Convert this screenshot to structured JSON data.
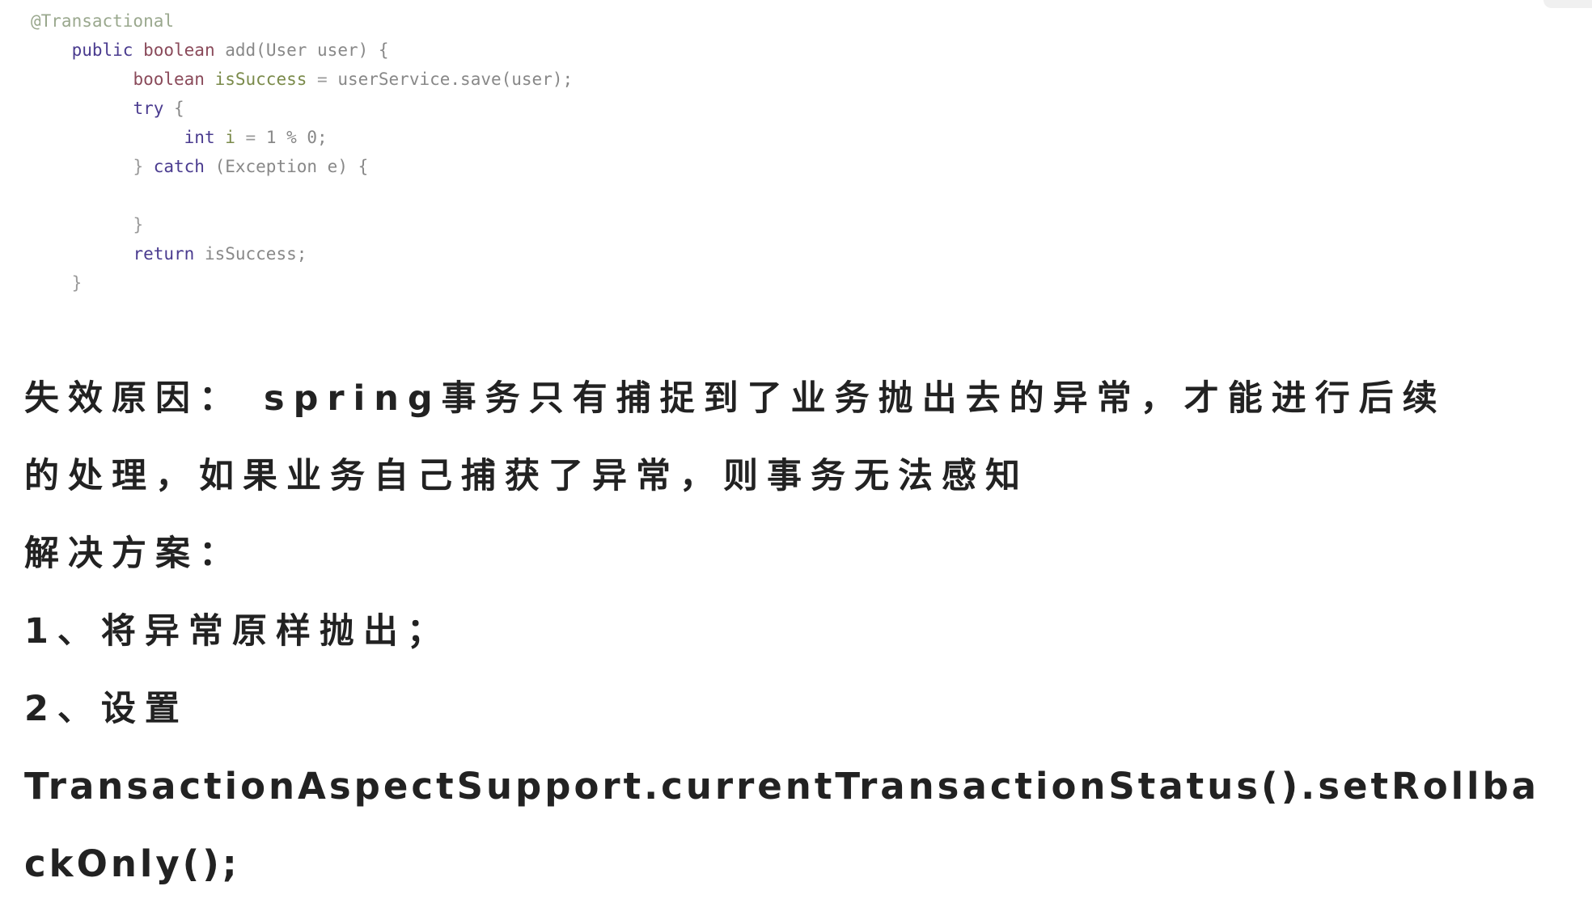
{
  "code": {
    "lines": [
      {
        "indent": "",
        "tokens": [
          {
            "cls": "tok-annotation",
            "text": "@Transactional"
          }
        ]
      },
      {
        "indent": "    ",
        "tokens": [
          {
            "cls": "tok-keyword",
            "text": "public "
          },
          {
            "cls": "tok-type",
            "text": "boolean "
          },
          {
            "cls": "tok-plain",
            "text": "add(User user) {"
          }
        ]
      },
      {
        "indent": "          ",
        "tokens": [
          {
            "cls": "tok-type",
            "text": "boolean "
          },
          {
            "cls": "tok-field",
            "text": "isSuccess"
          },
          {
            "cls": "tok-punct",
            "text": " = "
          },
          {
            "cls": "tok-plain",
            "text": "userService.save(user);"
          }
        ]
      },
      {
        "indent": "          ",
        "tokens": [
          {
            "cls": "tok-keyword",
            "text": "try"
          },
          {
            "cls": "tok-plain",
            "text": " {"
          }
        ]
      },
      {
        "indent": "               ",
        "tokens": [
          {
            "cls": "tok-keyword",
            "text": "int "
          },
          {
            "cls": "tok-field",
            "text": "i"
          },
          {
            "cls": "tok-punct",
            "text": " = "
          },
          {
            "cls": "tok-plain",
            "text": "1 % 0;"
          }
        ]
      },
      {
        "indent": "          ",
        "tokens": [
          {
            "cls": "tok-punct",
            "text": "} "
          },
          {
            "cls": "tok-keyword",
            "text": "catch"
          },
          {
            "cls": "tok-plain",
            "text": " (Exception e) {"
          }
        ]
      },
      {
        "indent": "",
        "tokens": []
      },
      {
        "indent": "          ",
        "tokens": [
          {
            "cls": "tok-punct",
            "text": "}"
          }
        ]
      },
      {
        "indent": "          ",
        "tokens": [
          {
            "cls": "tok-keyword",
            "text": "return "
          },
          {
            "cls": "tok-plain",
            "text": "isSuccess;"
          }
        ]
      },
      {
        "indent": "    ",
        "tokens": [
          {
            "cls": "tok-punct",
            "text": "}"
          }
        ]
      }
    ]
  },
  "explanation": {
    "cause_line1": "失效原因： spring事务只有捕捉到了业务抛出去的异常，才能进行后续",
    "cause_line2": "的处理，如果业务自己捕获了异常，则事务无法感知",
    "solution_heading": "解决方案：",
    "solution_1": "1、将异常原样抛出；",
    "solution_2": "2、设置",
    "solution_code_part1": "TransactionAspectSupport.currentTransactionStatus().setRollba",
    "solution_code_part2": "ckOnly();"
  }
}
